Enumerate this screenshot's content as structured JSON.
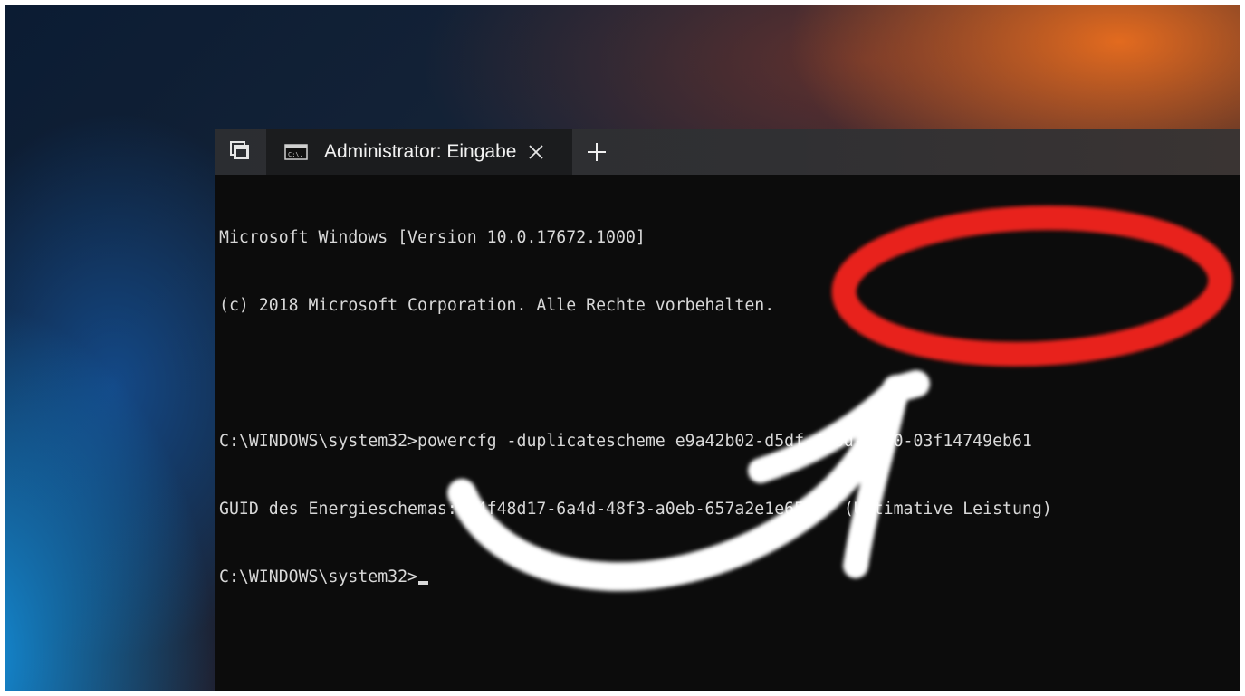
{
  "tab_switcher": {
    "icon": "tabs-icon"
  },
  "tab": {
    "icon": "cmd-icon",
    "icon_text": "C:\\.",
    "title": "Administrator: Eingabe",
    "close_icon": "close-icon"
  },
  "new_tab": {
    "icon": "plus-icon"
  },
  "console": {
    "lines": [
      "Microsoft Windows [Version 10.0.17672.1000]",
      "(c) 2018 Microsoft Corporation. Alle Rechte vorbehalten.",
      "",
      "C:\\WINDOWS\\system32>powercfg -duplicatescheme e9a42b02-d5df-448d-aa00-03f14749eb61",
      "GUID des Energieschemas: c4f48d17-6a4d-48f3-a0eb-657a2e1e6547  (Ultimative Leistung)"
    ],
    "prompt": "C:\\WINDOWS\\system32>"
  },
  "annotations": {
    "highlight_color": "#e8231b",
    "arrow_color": "#ffffff"
  }
}
